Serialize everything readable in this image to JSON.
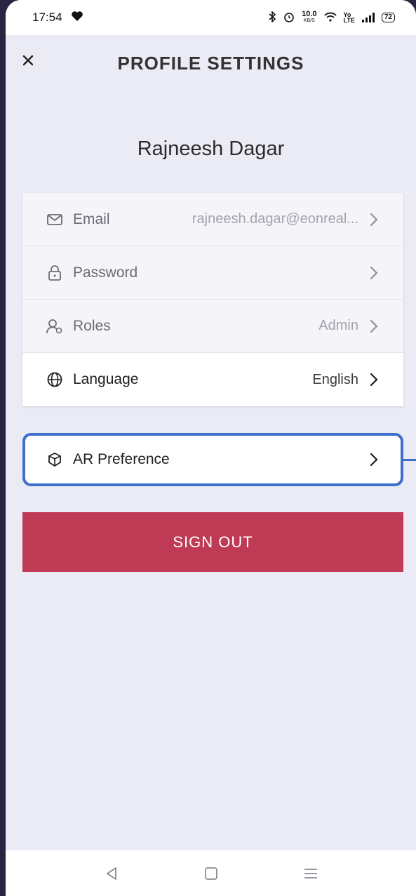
{
  "status_bar": {
    "time": "17:54",
    "network_speed": "10.0",
    "network_unit": "KB/S",
    "battery": "72"
  },
  "header": {
    "title": "PROFILE SETTINGS"
  },
  "profile": {
    "name": "Rajneesh Dagar"
  },
  "settings": {
    "email": {
      "label": "Email",
      "value": "rajneesh.dagar@eonreal...",
      "icon": "mail-icon"
    },
    "password": {
      "label": "Password",
      "value": "",
      "icon": "lock-icon"
    },
    "roles": {
      "label": "Roles",
      "value": "Admin",
      "icon": "user-icon"
    },
    "language": {
      "label": "Language",
      "value": "English",
      "icon": "globe-icon"
    }
  },
  "ar_preference": {
    "label": "AR Preference",
    "icon": "cube-icon"
  },
  "sign_out": {
    "label": "SIGN OUT"
  },
  "colors": {
    "accent": "#3e6fcc",
    "danger": "#bf3a54",
    "background": "#ebebf5"
  }
}
